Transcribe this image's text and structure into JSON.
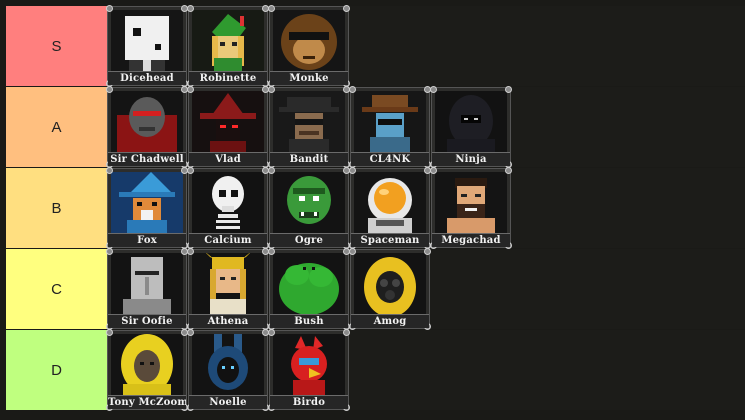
{
  "tiers": [
    {
      "label": "S",
      "color": "#ff7f7e",
      "items": [
        {
          "name": "Dicehead",
          "icon": "dice-head-icon"
        },
        {
          "name": "Robinette",
          "icon": "archer-hood-icon"
        },
        {
          "name": "Monke",
          "icon": "monkey-sunglasses-icon"
        }
      ]
    },
    {
      "label": "A",
      "color": "#ffbf7f",
      "items": [
        {
          "name": "Sir Chadwell",
          "icon": "knight-helmet-icon"
        },
        {
          "name": "Vlad",
          "icon": "witch-hat-icon"
        },
        {
          "name": "Bandit",
          "icon": "bandit-mask-icon"
        },
        {
          "name": "CL4NK",
          "icon": "robot-cowboy-icon"
        },
        {
          "name": "Ninja",
          "icon": "ninja-hood-icon"
        }
      ]
    },
    {
      "label": "B",
      "color": "#ffdf80",
      "items": [
        {
          "name": "Fox",
          "icon": "fox-wizard-icon"
        },
        {
          "name": "Calcium",
          "icon": "skeleton-icon"
        },
        {
          "name": "Ogre",
          "icon": "ogre-icon"
        },
        {
          "name": "Spaceman",
          "icon": "astronaut-icon"
        },
        {
          "name": "Megachad",
          "icon": "bearded-man-icon"
        }
      ]
    },
    {
      "label": "C",
      "color": "#ffff7f",
      "items": [
        {
          "name": "Sir Oofie",
          "icon": "knight-visor-icon"
        },
        {
          "name": "Athena",
          "icon": "valkyrie-icon"
        },
        {
          "name": "Bush",
          "icon": "bush-icon"
        },
        {
          "name": "Amog",
          "icon": "gas-mask-icon"
        }
      ]
    },
    {
      "label": "D",
      "color": "#bfff7f",
      "items": [
        {
          "name": "Tony McZoom",
          "icon": "yellow-hood-icon"
        },
        {
          "name": "Noelle",
          "icon": "bunny-mask-icon"
        },
        {
          "name": "Birdo",
          "icon": "red-bird-icon"
        }
      ]
    }
  ]
}
